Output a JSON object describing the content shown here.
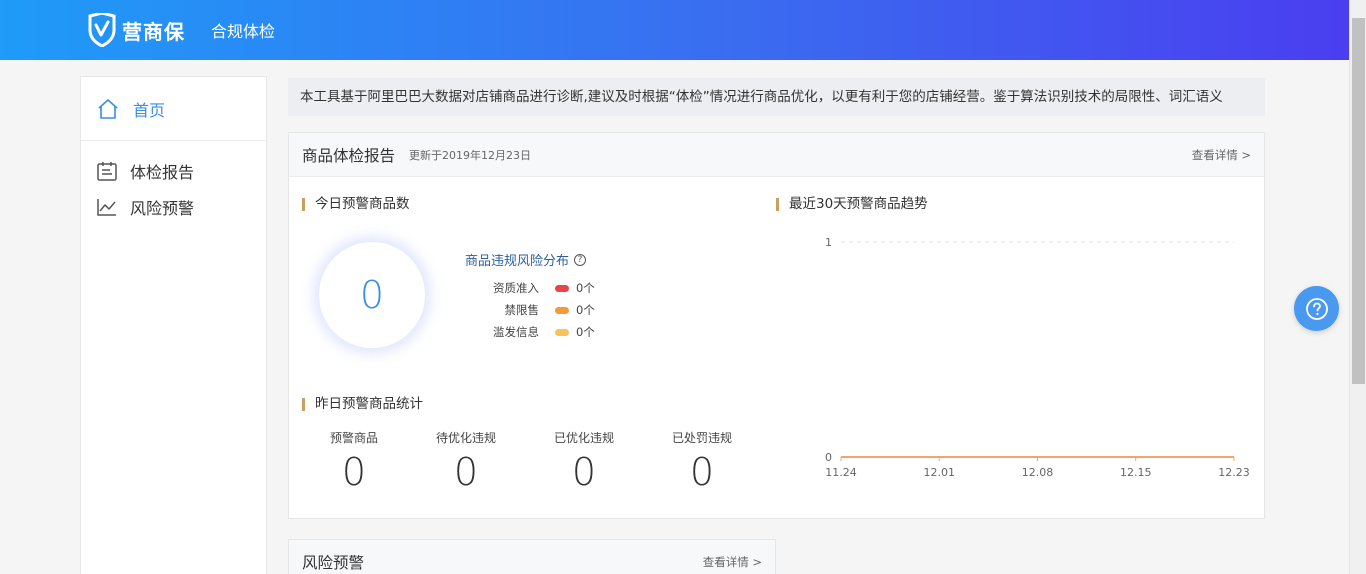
{
  "header": {
    "logo_text": "营商保",
    "subtitle": "合规体检"
  },
  "sidebar": {
    "home": "首页",
    "items": [
      {
        "label": "体检报告",
        "icon": "report-icon"
      },
      {
        "label": "风险预警",
        "icon": "trend-icon"
      }
    ]
  },
  "notice": "本工具基于阿里巴巴大数据对店铺商品进行诊断,建议及时根据“体检”情况进行商品优化，以更有利于您的店铺经营。鉴于算法识别技术的局限性、词汇语义",
  "report": {
    "title": "商品体检报告",
    "updated": "更新于2019年12月23日",
    "more": "查看详情 >",
    "today_title": "今日预警商品数",
    "today_count": "0",
    "dist_title": "商品违规风险分布",
    "dist": [
      {
        "label": "资质准入",
        "value": "0个",
        "color": "#e84545"
      },
      {
        "label": "禁限售",
        "value": "0个",
        "color": "#f39a3b"
      },
      {
        "label": "滥发信息",
        "value": "0个",
        "color": "#f7c35c"
      }
    ],
    "yesterday_title": "昨日预警商品统计",
    "stats": [
      {
        "label": "预警商品",
        "value": "0"
      },
      {
        "label": "待优化违规",
        "value": "0"
      },
      {
        "label": "已优化违规",
        "value": "0"
      },
      {
        "label": "已处罚违规",
        "value": "0"
      }
    ],
    "trend_title": "最近30天预警商品趋势"
  },
  "chart_data": {
    "type": "line",
    "title": "最近30天预警商品趋势",
    "x": [
      "11.24",
      "12.01",
      "12.08",
      "12.15",
      "12.23"
    ],
    "series": [
      {
        "values": [
          0,
          0,
          0,
          0,
          0
        ],
        "color": "#f3a46a"
      }
    ],
    "ylim": [
      0,
      1
    ],
    "yticks": [
      "0",
      "1"
    ],
    "grid": true
  },
  "risk_panel": {
    "title": "风险预警",
    "more": "查看详情 >"
  }
}
